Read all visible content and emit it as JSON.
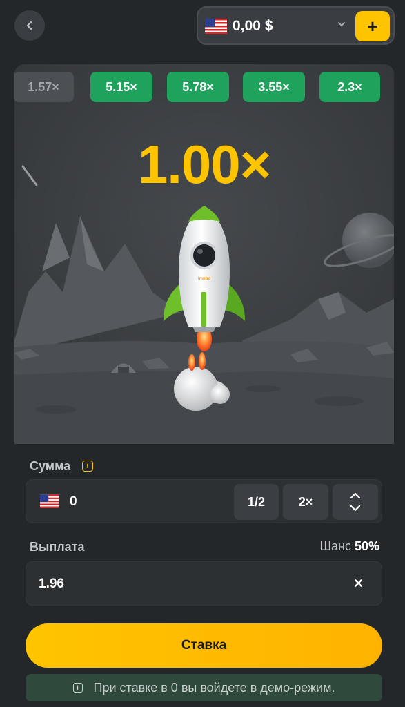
{
  "header": {
    "balance": "0,00 $",
    "deposit_label": "+",
    "flag_icon": "us-flag-icon"
  },
  "history": [
    "1.57×",
    "5.15×",
    "5.78×",
    "3.55×",
    "2.3×"
  ],
  "game": {
    "multiplier": "1.00×",
    "rocket_brand": "lmnbo"
  },
  "bet": {
    "amount_label": "Сумма",
    "amount_value": "0",
    "half_label": "1/2",
    "double_label": "2×",
    "payout_label": "Выплата",
    "chance_label": "Шанс",
    "chance_value": "50%",
    "payout_value": "1.96",
    "clear_label": "×",
    "button_label": "Ставка",
    "notice": "При ставке в 0 вы войдете в демо-режим."
  },
  "colors": {
    "accent": "#ffc400",
    "green": "#1fa35c",
    "background": "#24272a"
  }
}
